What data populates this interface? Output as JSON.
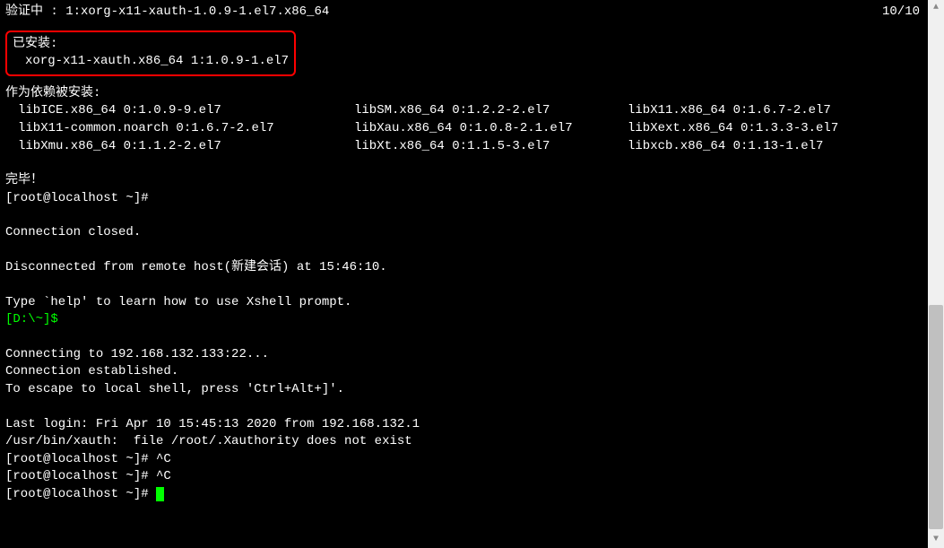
{
  "topLine": {
    "left": "验证中         : 1:xorg-x11-xauth-1.0.9-1.el7.x86_64",
    "right": "10/10"
  },
  "installed": {
    "header": "已安装:",
    "package": "xorg-x11-xauth.x86_64 1:1.0.9-1.el7"
  },
  "depsHeader": "作为依赖被安装:",
  "deps": [
    [
      "libICE.x86_64 0:1.0.9-9.el7",
      "libSM.x86_64 0:1.2.2-2.el7",
      "libX11.x86_64 0:1.6.7-2.el7"
    ],
    [
      "libX11-common.noarch 0:1.6.7-2.el7",
      "libXau.x86_64 0:1.0.8-2.1.el7",
      "libXext.x86_64 0:1.3.3-3.el7"
    ],
    [
      "libXmu.x86_64 0:1.1.2-2.el7",
      "libXt.x86_64 0:1.1.5-3.el7",
      "libxcb.x86_64 0:1.13-1.el7"
    ]
  ],
  "done": "完毕！",
  "prompt1": "[root@localhost ~]#",
  "connClosed": "Connection closed.",
  "disconnected": "Disconnected from remote host(新建会话) at 15:46:10.",
  "helpLine": "Type `help' to learn how to use Xshell prompt.",
  "localPrompt": "[D:\\~]$",
  "connecting": "Connecting to 192.168.132.133:22...",
  "connEstablished": "Connection established.",
  "escapeLine": "To escape to local shell, press 'Ctrl+Alt+]'.",
  "lastLogin": "Last login: Fri Apr 10 15:45:13 2020 from 192.168.132.1",
  "xauthLine": "/usr/bin/xauth:  file /root/.Xauthority does not exist",
  "promptCtrlC1": "[root@localhost ~]# ^C",
  "promptCtrlC2": "[root@localhost ~]# ^C",
  "promptFinal": "[root@localhost ~]# "
}
